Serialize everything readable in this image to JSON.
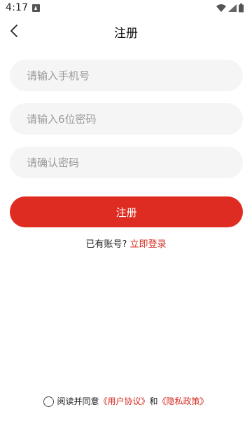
{
  "status_bar": {
    "time": "4:17",
    "icons": [
      "app-notification-icon",
      "wifi-icon",
      "signal-icon",
      "battery-icon"
    ]
  },
  "header": {
    "back_icon": "chevron-left-icon",
    "title": "注册"
  },
  "form": {
    "phone_placeholder": "请输入手机号",
    "password_placeholder": "请输入6位密码",
    "confirm_placeholder": "请确认密码",
    "submit_label": "注册"
  },
  "login_prompt": {
    "text": "已有账号?",
    "link": "立即登录"
  },
  "agreement": {
    "prefix": "阅读并同意",
    "user_agreement": "《用户协议》",
    "conjunction": "和",
    "privacy_policy": "《隐私政策》"
  },
  "colors": {
    "accent": "#df2c22",
    "field_bg": "#f5f5f5",
    "link": "#d62c22"
  }
}
